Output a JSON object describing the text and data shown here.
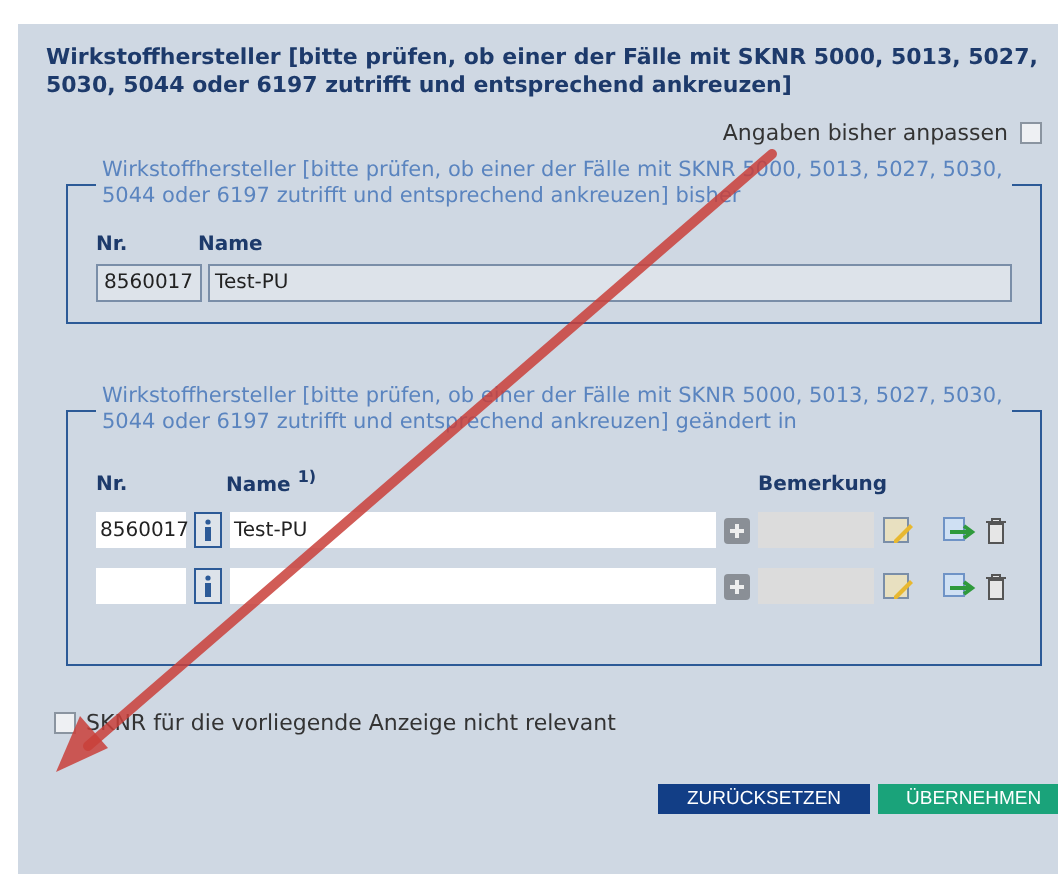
{
  "title": "Wirkstoffhersteller [bitte prüfen, ob einer der Fälle mit SKNR 5000, 5013, 5027, 5030, 5044 oder 6197 zutrifft und entsprechend ankreuzen]",
  "adjust": {
    "label": "Angaben bisher anpassen",
    "checked": false
  },
  "previous": {
    "legend": "Wirkstoffhersteller [bitte prüfen, ob einer der Fälle mit SKNR 5000, 5013, 5027, 5030, 5044 oder 6197 zutrifft und entsprechend ankreuzen] bisher",
    "columns": [
      "Nr.",
      "Name"
    ],
    "rows": [
      {
        "nr": "8560017",
        "name": "Test-PU"
      }
    ]
  },
  "changed": {
    "legend": "Wirkstoffhersteller [bitte prüfen, ob einer der Fälle mit SKNR 5000, 5013, 5027, 5030, 5044 oder 6197 zutrifft und entsprechend ankreuzen] geändert in",
    "columns": [
      "Nr.",
      "Name $^{1)}$",
      "Bemerkung"
    ],
    "rows": [
      {
        "nr": "8560017",
        "name": "Test-PU",
        "remark_disabled": true
      },
      {
        "remark_disabled": true
      }
    ]
  },
  "not_relevant": {
    "label": "SKNR für die vorliegende Anzeige nicht relevant",
    "checked": false
  },
  "buttons": [
    {
      "label": "ZURÜCKSETZEN",
      "kind": "reset"
    },
    {
      "label": "ÜBERNEHMEN",
      "kind": "apply"
    }
  ]
}
